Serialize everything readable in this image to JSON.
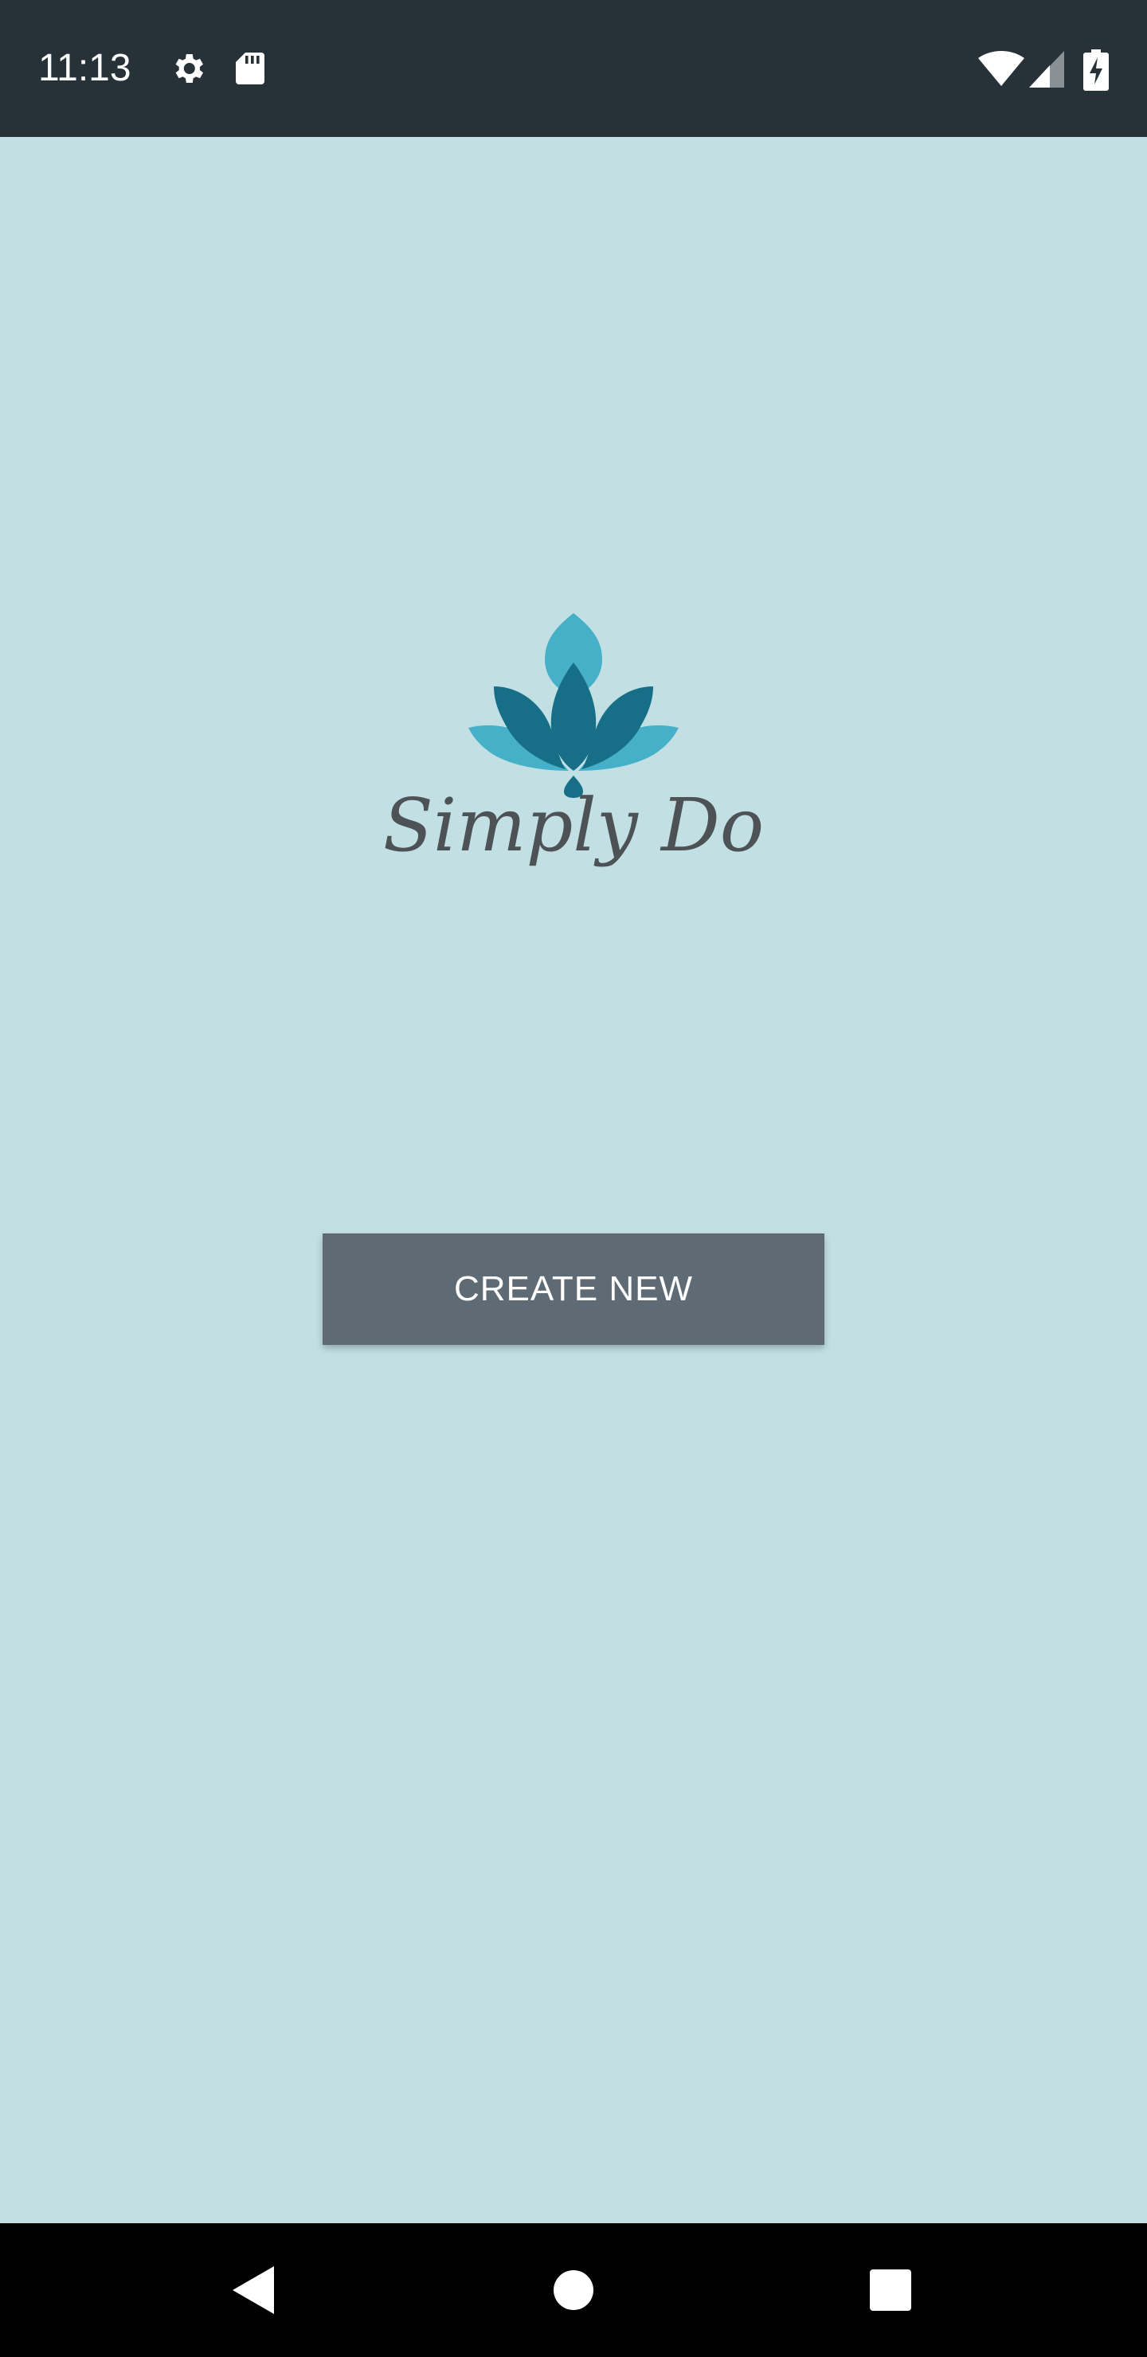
{
  "status_bar": {
    "time": "11:13",
    "icons": [
      "settings-icon",
      "sd-card-icon",
      "wifi-icon",
      "cell-signal-icon",
      "battery-charging-icon"
    ],
    "background": "#263238"
  },
  "app": {
    "brand_name": "Simply Do",
    "logo_icon": "lotus-icon",
    "background": "#c2e0e4",
    "accent_light": "#45b0c8",
    "accent_dark": "#166f86"
  },
  "main": {
    "create_button_label": "CREATE NEW",
    "button_color": "#5e6b74"
  },
  "nav_bar": {
    "buttons": [
      "back-icon",
      "home-icon",
      "recents-icon"
    ]
  }
}
